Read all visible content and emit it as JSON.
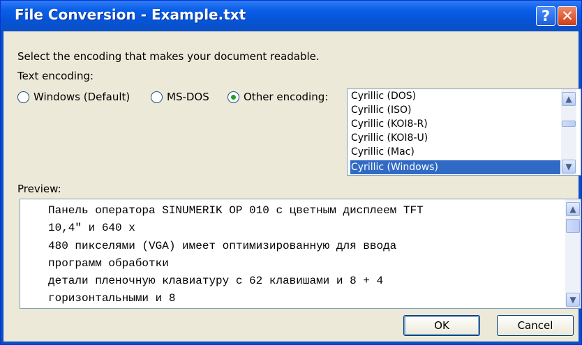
{
  "window": {
    "title": "File Conversion - Example.txt"
  },
  "titlebar": {
    "help_glyph": "?",
    "close_glyph": "✕"
  },
  "instructions": "Select the encoding that makes your document readable.",
  "encoding": {
    "label": "Text encoding:",
    "options": [
      {
        "label": "Windows (Default)",
        "selected": false
      },
      {
        "label": "MS-DOS",
        "selected": false
      },
      {
        "label": "Other encoding:",
        "selected": true
      }
    ],
    "list": [
      "Cyrillic (DOS)",
      "Cyrillic (ISO)",
      "Cyrillic (KOI8-R)",
      "Cyrillic (KOI8-U)",
      "Cyrillic (Mac)",
      "Cyrillic (Windows)"
    ],
    "selected_item": "Cyrillic (Windows)"
  },
  "preview": {
    "label": "Preview:",
    "lines": [
      "Панель оператора SINUMERIK OP 010 с цветным дисплеем TFT",
      "10,4″ и 640 x",
      "480 пикселями (VGA) имеет оптимизированную для ввода",
      "программ обработки",
      "детали пленочную клавиатуру с 62 клавишами и 8 + 4",
      "горизонтальными и 8"
    ]
  },
  "buttons": {
    "ok": "OK",
    "cancel": "Cancel"
  }
}
